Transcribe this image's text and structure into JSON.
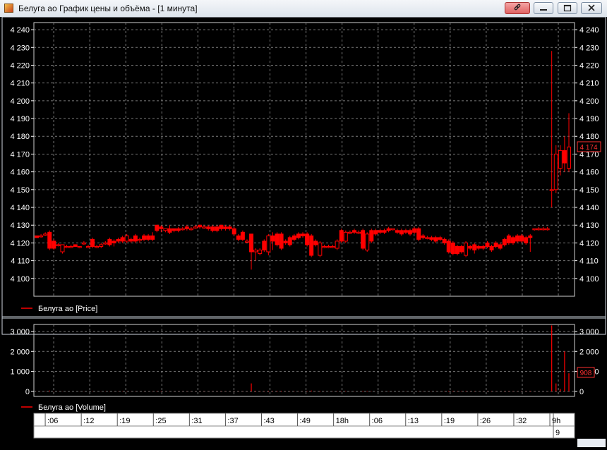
{
  "window": {
    "title": "Белуга ао График цены и объёма - [1 минута]",
    "icons": {
      "app": "chart-app-icon",
      "link": "link-icon",
      "minimize": "minimize-icon",
      "maximize": "maximize-icon",
      "close": "close-icon"
    }
  },
  "colors": {
    "background": "#000000",
    "candle": "#ff0000",
    "grid": "#7a7a7a",
    "axis_text": "#ffffff",
    "title_link_button": "#e06363"
  },
  "chart_data": [
    {
      "type": "candlestick",
      "series": [
        {
          "name": "Белуга ао [Price]"
        }
      ],
      "legend_label": "Белуга ао [Price]",
      "legend_position": "bottom-left",
      "ylim": [
        4090,
        4244
      ],
      "y_ticks": [
        4100,
        4110,
        4120,
        4130,
        4140,
        4150,
        4160,
        4170,
        4180,
        4190,
        4200,
        4210,
        4220,
        4230,
        4240
      ],
      "y_tick_labels": [
        "4 100",
        "4 110",
        "4 120",
        "4 130",
        "4 140",
        "4 150",
        "4 160",
        "4 170",
        "4 180",
        "4 190",
        "4 200",
        "4 210",
        "4 220",
        "4 230",
        "4 240"
      ],
      "grid": true,
      "last_price_label": "4 174",
      "last_price_value": 4174,
      "candles": [
        [
          4124,
          4124,
          4123,
          4123
        ],
        [
          4124,
          4125,
          4123,
          4124
        ],
        [
          4125,
          4126,
          4124,
          4125
        ],
        [
          4126,
          4127,
          4116,
          4117
        ],
        [
          4121,
          4122,
          4116,
          4117
        ],
        [
          4119,
          4120,
          4118,
          4119
        ],
        [
          4115,
          4119,
          4114,
          4119
        ],
        [
          4118,
          4119,
          4117,
          4118
        ],
        [
          4118,
          4119,
          4117,
          4118
        ],
        [
          4119,
          4119,
          4118,
          4118
        ],
        [
          4118,
          4118,
          4117,
          4118
        ],
        [
          4120,
          4121,
          4119,
          4120
        ],
        [
          4118,
          4119,
          4117,
          4118
        ],
        [
          4122,
          4123,
          4117,
          4118
        ],
        [
          4118,
          4119,
          4117,
          4118
        ],
        [
          4118,
          4120,
          4117,
          4119
        ],
        [
          4120,
          4121,
          4119,
          4120
        ],
        [
          4122,
          4123,
          4118,
          4119
        ],
        [
          4121,
          4122,
          4118,
          4120
        ],
        [
          4122,
          4123,
          4120,
          4121
        ],
        [
          4123,
          4124,
          4120,
          4121
        ],
        [
          4121,
          4125,
          4120,
          4124
        ],
        [
          4122,
          4123,
          4120,
          4121
        ],
        [
          4124,
          4125,
          4120,
          4121
        ],
        [
          4122,
          4123,
          4120,
          4122
        ],
        [
          4124,
          4125,
          4121,
          4122
        ],
        [
          4124,
          4125,
          4121,
          4122
        ],
        [
          4124,
          4126,
          4121,
          4122
        ],
        [
          4130,
          4130,
          4126,
          4127
        ],
        [
          4129,
          4130,
          4126,
          4128
        ],
        [
          4127,
          4128,
          4126,
          4128
        ],
        [
          4128,
          4130,
          4125,
          4126
        ],
        [
          4128,
          4128,
          4126,
          4127
        ],
        [
          4128,
          4129,
          4126,
          4127
        ],
        [
          4128,
          4129,
          4127,
          4128
        ],
        [
          4129,
          4130,
          4127,
          4128
        ],
        [
          4128,
          4129,
          4127,
          4128
        ],
        [
          4129,
          4130,
          4128,
          4129
        ],
        [
          4130,
          4130,
          4128,
          4129
        ],
        [
          4129,
          4130,
          4128,
          4129
        ],
        [
          4129,
          4130,
          4127,
          4128
        ],
        [
          4129,
          4130,
          4126,
          4127
        ],
        [
          4129,
          4130,
          4126,
          4127
        ],
        [
          4130,
          4130,
          4127,
          4128
        ],
        [
          4129,
          4130,
          4127,
          4128
        ],
        [
          4129,
          4130,
          4127,
          4128
        ],
        [
          4128,
          4129,
          4124,
          4125
        ],
        [
          4124,
          4125,
          4121,
          4122
        ],
        [
          4126,
          4127,
          4121,
          4122
        ],
        [
          4121,
          4122,
          4120,
          4121
        ],
        [
          4125,
          4125,
          4105,
          4115
        ],
        [
          4115,
          4117,
          4110,
          4116
        ],
        [
          4114,
          4117,
          4113,
          4116
        ],
        [
          4121,
          4122,
          4115,
          4116
        ],
        [
          4115,
          4125,
          4113,
          4124
        ],
        [
          4124,
          4126,
          4116,
          4121
        ],
        [
          4125,
          4126,
          4118,
          4119
        ],
        [
          4125,
          4126,
          4116,
          4117
        ],
        [
          4121,
          4122,
          4119,
          4120
        ],
        [
          4123,
          4124,
          4118,
          4119
        ],
        [
          4124,
          4125,
          4121,
          4122
        ],
        [
          4125,
          4126,
          4122,
          4123
        ],
        [
          4125,
          4126,
          4123,
          4124
        ],
        [
          4125,
          4126,
          4118,
          4119
        ],
        [
          4124,
          4125,
          4112,
          4113
        ],
        [
          4121,
          4122,
          4118,
          4119
        ],
        [
          4113,
          4121,
          4112,
          4120
        ],
        [
          4118,
          4119,
          4117,
          4118
        ],
        [
          4118,
          4119,
          4117,
          4118
        ],
        [
          4118,
          4119,
          4117,
          4118
        ],
        [
          4117,
          4122,
          4116,
          4121
        ],
        [
          4127,
          4128,
          4120,
          4121
        ],
        [
          4121,
          4127,
          4120,
          4126
        ],
        [
          4126,
          4127,
          4125,
          4126
        ],
        [
          4127,
          4128,
          4125,
          4126
        ],
        [
          4126,
          4127,
          4125,
          4126
        ],
        [
          4127,
          4128,
          4116,
          4117
        ],
        [
          4116,
          4126,
          4115,
          4125
        ],
        [
          4127,
          4128,
          4120,
          4121
        ],
        [
          4127,
          4128,
          4124,
          4125
        ],
        [
          4127,
          4128,
          4125,
          4126
        ],
        [
          4127,
          4128,
          4125,
          4126
        ],
        [
          4128,
          4129,
          4126,
          4127
        ],
        [
          4128,
          4128,
          4127,
          4128
        ],
        [
          4127,
          4128,
          4125,
          4126
        ],
        [
          4127,
          4128,
          4124,
          4125
        ],
        [
          4127,
          4128,
          4125,
          4126
        ],
        [
          4127,
          4128,
          4124,
          4125
        ],
        [
          4128,
          4129,
          4125,
          4126
        ],
        [
          4128,
          4129,
          4121,
          4122
        ],
        [
          4124,
          4125,
          4122,
          4123
        ],
        [
          4123,
          4124,
          4122,
          4123
        ],
        [
          4123,
          4124,
          4121,
          4122
        ],
        [
          4123,
          4124,
          4120,
          4121
        ],
        [
          4123,
          4124,
          4121,
          4122
        ],
        [
          4122,
          4123,
          4119,
          4120
        ],
        [
          4121,
          4122,
          4114,
          4115
        ],
        [
          4120,
          4121,
          4113,
          4114
        ],
        [
          4118,
          4119,
          4113,
          4114
        ],
        [
          4118,
          4119,
          4114,
          4115
        ],
        [
          4113,
          4121,
          4112,
          4120
        ],
        [
          4118,
          4119,
          4116,
          4117
        ],
        [
          4119,
          4120,
          4114,
          4116
        ],
        [
          4118,
          4119,
          4116,
          4117
        ],
        [
          4118,
          4119,
          4116,
          4117
        ],
        [
          4120,
          4121,
          4117,
          4118
        ],
        [
          4118,
          4119,
          4115,
          4116
        ],
        [
          4120,
          4121,
          4117,
          4118
        ],
        [
          4119,
          4120,
          4116,
          4117
        ],
        [
          4122,
          4123,
          4118,
          4119
        ],
        [
          4124,
          4125,
          4119,
          4120
        ],
        [
          4123,
          4124,
          4119,
          4120
        ],
        [
          4124,
          4125,
          4120,
          4121
        ],
        [
          4124,
          4125,
          4120,
          4121
        ],
        [
          4123,
          4124,
          4119,
          4120
        ],
        [
          4124,
          4125,
          4115,
          4123
        ],
        [
          4128,
          4128,
          4127,
          4128
        ],
        [
          4128,
          4129,
          4127,
          4128
        ],
        [
          4128,
          4129,
          4127,
          4128
        ],
        [
          4128,
          4129,
          4127,
          4128
        ],
        [
          4150,
          4228,
          4140,
          4150
        ],
        [
          4150,
          4175,
          4148,
          4170
        ],
        [
          4162,
          4175,
          4158,
          4172
        ],
        [
          4172,
          4180,
          4160,
          4165
        ],
        [
          4162,
          4193,
          4160,
          4174
        ]
      ]
    },
    {
      "type": "bar",
      "series": [
        {
          "name": "Белуга ао [Volume]"
        }
      ],
      "legend_label": "Белуга ао [Volume]",
      "legend_position": "bottom-left",
      "ylim": [
        -250,
        3350
      ],
      "y_ticks": [
        0,
        1000,
        2000,
        3000
      ],
      "y_tick_labels": [
        "0",
        "1 000",
        "2 000",
        "3 000"
      ],
      "grid": true,
      "last_value_label": "908",
      "last_value": 908,
      "volumes": [
        10,
        8,
        12,
        40,
        20,
        8,
        6,
        5,
        6,
        4,
        5,
        8,
        5,
        15,
        4,
        6,
        10,
        12,
        8,
        10,
        12,
        14,
        8,
        10,
        6,
        8,
        6,
        10,
        20,
        18,
        8,
        10,
        8,
        8,
        6,
        10,
        8,
        6,
        8,
        10,
        6,
        8,
        10,
        12,
        8,
        6,
        8,
        10,
        8,
        6,
        400,
        30,
        20,
        15,
        25,
        20,
        30,
        25,
        10,
        12,
        14,
        10,
        8,
        20,
        40,
        12,
        25,
        8,
        6,
        8,
        18,
        20,
        22,
        8,
        10,
        8,
        30,
        25,
        12,
        8,
        6,
        6,
        10,
        6,
        8,
        6,
        8,
        6,
        8,
        14,
        8,
        6,
        8,
        10,
        8,
        12,
        30,
        25,
        20,
        18,
        22,
        10,
        14,
        8,
        8,
        10,
        12,
        10,
        8,
        14,
        16,
        12,
        10,
        10,
        12,
        20,
        6,
        6,
        6,
        6,
        3300,
        400,
        120,
        2000,
        908
      ],
      "time_axis": {
        "labels": [
          ":06",
          ":12",
          ":19",
          ":25",
          ":31",
          ":37",
          ":43",
          ":49",
          "18h",
          ":06",
          ":13",
          ":19",
          ":26",
          ":32",
          "9h"
        ],
        "second_row_label": "9"
      }
    }
  ]
}
